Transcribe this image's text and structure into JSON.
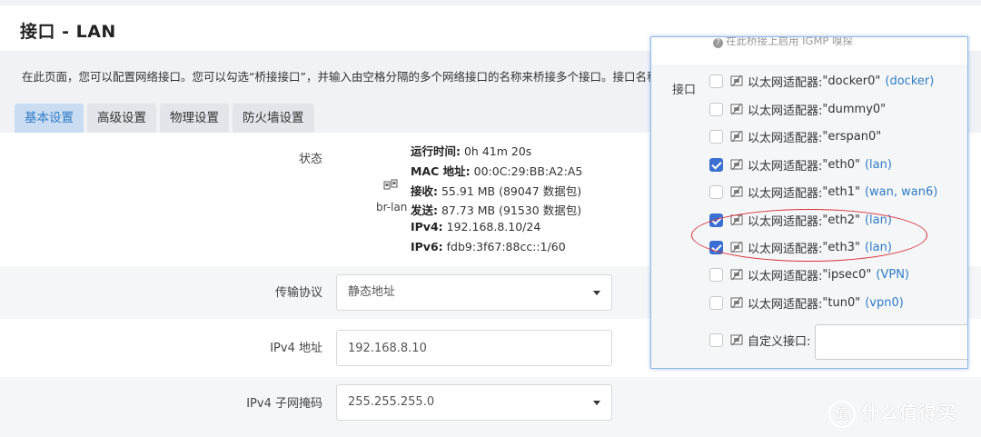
{
  "page": {
    "title": "接口 - LAN",
    "description": "在此页面，您可以配置网络接口。您可以勾选“桥接接口”，并输入由空格分隔的多个网络接口的名称来桥接多个接口。接口名称中"
  },
  "tabs": [
    "基本设置",
    "高级设置",
    "物理设置",
    "防火墙设置"
  ],
  "status": {
    "label": "状态",
    "device": "br-lan",
    "uptime_label": "运行时间:",
    "uptime_value": "0h 41m 20s",
    "mac_label": "MAC 地址:",
    "mac_value": "00:0C:29:BB:A2:A5",
    "rx_label": "接收:",
    "rx_value": "55.91 MB (89047 数据包)",
    "tx_label": "发送:",
    "tx_value": "87.73 MB (91530 数据包)",
    "ipv4_label": "IPv4:",
    "ipv4_value": "192.168.8.10/24",
    "ipv6_label": "IPv6:",
    "ipv6_value": "fdb9:3f67:88cc::1/60"
  },
  "form": {
    "protocol_label": "传输协议",
    "protocol_value": "静态地址",
    "ipv4_label": "IPv4 地址",
    "ipv4_value": "192.168.8.10",
    "netmask_label": "IPv4 子网掩码",
    "netmask_value": "255.255.255.0"
  },
  "popup": {
    "hint": "在此桥接上启用 IGMP 嗅探",
    "interface_label": "接口",
    "options": [
      {
        "prefix": "以太网适配器:",
        "name": "\"docker0\"",
        "zone": "(docker)",
        "checked": false
      },
      {
        "prefix": "以太网适配器:",
        "name": "\"dummy0\"",
        "zone": "",
        "checked": false
      },
      {
        "prefix": "以太网适配器:",
        "name": "\"erspan0\"",
        "zone": "",
        "checked": false
      },
      {
        "prefix": "以太网适配器:",
        "name": "\"eth0\"",
        "zone": "(lan)",
        "checked": true
      },
      {
        "prefix": "以太网适配器:",
        "name": "\"eth1\"",
        "zone": "(wan, wan6)",
        "checked": false
      },
      {
        "prefix": "以太网适配器:",
        "name": "\"eth2\"",
        "zone": "(lan)",
        "checked": true
      },
      {
        "prefix": "以太网适配器:",
        "name": "\"eth3\"",
        "zone": "(lan)",
        "checked": true
      },
      {
        "prefix": "以太网适配器:",
        "name": "\"ipsec0\"",
        "zone": "(VPN)",
        "checked": false
      },
      {
        "prefix": "以太网适配器:",
        "name": "\"tun0\"",
        "zone": "(vpn0)",
        "checked": false
      }
    ],
    "custom_label": "自定义接口:"
  },
  "watermark": "什么值得买",
  "colors": {
    "accent": "#2f7cc7",
    "checkbox": "#3b6fd1",
    "annotation": "#d9303a"
  },
  "icons": {
    "nic": "ethernet-adapter-icon",
    "hint": "info-icon"
  }
}
